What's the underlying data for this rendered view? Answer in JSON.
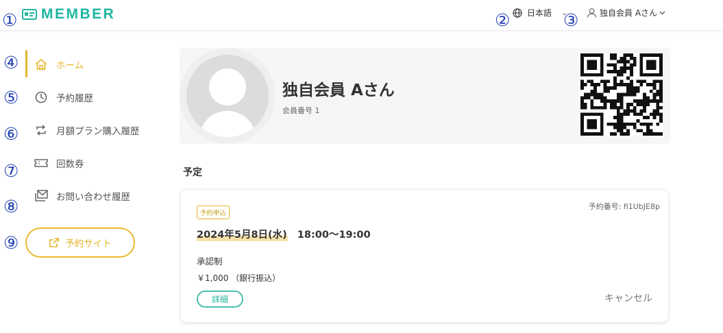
{
  "header": {
    "logo_text": "MEMBER",
    "language": "日本語",
    "user_name": "独自会員 Aさん"
  },
  "annotations": [
    "①",
    "②",
    "③",
    "④",
    "⑤",
    "⑥",
    "⑦",
    "⑧",
    "⑨"
  ],
  "sidebar": {
    "items": [
      {
        "label": "ホーム",
        "icon": "home-icon",
        "active": true
      },
      {
        "label": "予約履歴",
        "icon": "clock-icon"
      },
      {
        "label": "月額プラン購入履歴",
        "icon": "repeat-icon"
      },
      {
        "label": "回数券",
        "icon": "ticket-icon"
      },
      {
        "label": "お問い合わせ履歴",
        "icon": "mail-icon"
      }
    ],
    "site_button": "予約サイト"
  },
  "profile": {
    "name": "独自会員 Aさん",
    "member_no": "会員番号 1"
  },
  "schedule": {
    "title": "予定",
    "reservation": {
      "badge": "予約申込",
      "number": "予約番号: fi1UbJE8p",
      "date": "2024年5月8日(水)",
      "time": "18:00〜19:00",
      "approval": "承認制",
      "price": "￥1,000 （銀行振込）",
      "detail_button": "詳細",
      "cancel_link": "キャンセル"
    }
  },
  "colors": {
    "brand": "#1fb5a0",
    "accent": "#e5b52a",
    "annotation": "#2140b4"
  }
}
